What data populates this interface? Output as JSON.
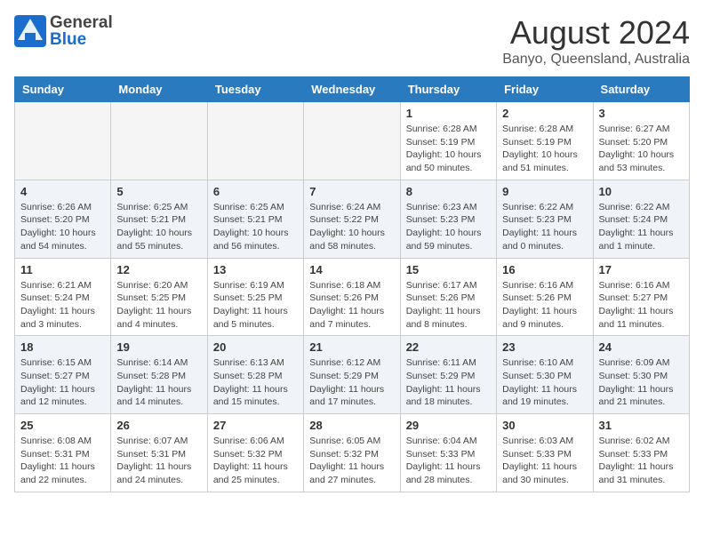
{
  "header": {
    "logo_general": "General",
    "logo_blue": "Blue",
    "month_title": "August 2024",
    "location": "Banyo, Queensland, Australia"
  },
  "weekdays": [
    "Sunday",
    "Monday",
    "Tuesday",
    "Wednesday",
    "Thursday",
    "Friday",
    "Saturday"
  ],
  "weeks": [
    [
      {
        "day": "",
        "info": ""
      },
      {
        "day": "",
        "info": ""
      },
      {
        "day": "",
        "info": ""
      },
      {
        "day": "",
        "info": ""
      },
      {
        "day": "1",
        "info": "Sunrise: 6:28 AM\nSunset: 5:19 PM\nDaylight: 10 hours\nand 50 minutes."
      },
      {
        "day": "2",
        "info": "Sunrise: 6:28 AM\nSunset: 5:19 PM\nDaylight: 10 hours\nand 51 minutes."
      },
      {
        "day": "3",
        "info": "Sunrise: 6:27 AM\nSunset: 5:20 PM\nDaylight: 10 hours\nand 53 minutes."
      }
    ],
    [
      {
        "day": "4",
        "info": "Sunrise: 6:26 AM\nSunset: 5:20 PM\nDaylight: 10 hours\nand 54 minutes."
      },
      {
        "day": "5",
        "info": "Sunrise: 6:25 AM\nSunset: 5:21 PM\nDaylight: 10 hours\nand 55 minutes."
      },
      {
        "day": "6",
        "info": "Sunrise: 6:25 AM\nSunset: 5:21 PM\nDaylight: 10 hours\nand 56 minutes."
      },
      {
        "day": "7",
        "info": "Sunrise: 6:24 AM\nSunset: 5:22 PM\nDaylight: 10 hours\nand 58 minutes."
      },
      {
        "day": "8",
        "info": "Sunrise: 6:23 AM\nSunset: 5:23 PM\nDaylight: 10 hours\nand 59 minutes."
      },
      {
        "day": "9",
        "info": "Sunrise: 6:22 AM\nSunset: 5:23 PM\nDaylight: 11 hours\nand 0 minutes."
      },
      {
        "day": "10",
        "info": "Sunrise: 6:22 AM\nSunset: 5:24 PM\nDaylight: 11 hours\nand 1 minute."
      }
    ],
    [
      {
        "day": "11",
        "info": "Sunrise: 6:21 AM\nSunset: 5:24 PM\nDaylight: 11 hours\nand 3 minutes."
      },
      {
        "day": "12",
        "info": "Sunrise: 6:20 AM\nSunset: 5:25 PM\nDaylight: 11 hours\nand 4 minutes."
      },
      {
        "day": "13",
        "info": "Sunrise: 6:19 AM\nSunset: 5:25 PM\nDaylight: 11 hours\nand 5 minutes."
      },
      {
        "day": "14",
        "info": "Sunrise: 6:18 AM\nSunset: 5:26 PM\nDaylight: 11 hours\nand 7 minutes."
      },
      {
        "day": "15",
        "info": "Sunrise: 6:17 AM\nSunset: 5:26 PM\nDaylight: 11 hours\nand 8 minutes."
      },
      {
        "day": "16",
        "info": "Sunrise: 6:16 AM\nSunset: 5:26 PM\nDaylight: 11 hours\nand 9 minutes."
      },
      {
        "day": "17",
        "info": "Sunrise: 6:16 AM\nSunset: 5:27 PM\nDaylight: 11 hours\nand 11 minutes."
      }
    ],
    [
      {
        "day": "18",
        "info": "Sunrise: 6:15 AM\nSunset: 5:27 PM\nDaylight: 11 hours\nand 12 minutes."
      },
      {
        "day": "19",
        "info": "Sunrise: 6:14 AM\nSunset: 5:28 PM\nDaylight: 11 hours\nand 14 minutes."
      },
      {
        "day": "20",
        "info": "Sunrise: 6:13 AM\nSunset: 5:28 PM\nDaylight: 11 hours\nand 15 minutes."
      },
      {
        "day": "21",
        "info": "Sunrise: 6:12 AM\nSunset: 5:29 PM\nDaylight: 11 hours\nand 17 minutes."
      },
      {
        "day": "22",
        "info": "Sunrise: 6:11 AM\nSunset: 5:29 PM\nDaylight: 11 hours\nand 18 minutes."
      },
      {
        "day": "23",
        "info": "Sunrise: 6:10 AM\nSunset: 5:30 PM\nDaylight: 11 hours\nand 19 minutes."
      },
      {
        "day": "24",
        "info": "Sunrise: 6:09 AM\nSunset: 5:30 PM\nDaylight: 11 hours\nand 21 minutes."
      }
    ],
    [
      {
        "day": "25",
        "info": "Sunrise: 6:08 AM\nSunset: 5:31 PM\nDaylight: 11 hours\nand 22 minutes."
      },
      {
        "day": "26",
        "info": "Sunrise: 6:07 AM\nSunset: 5:31 PM\nDaylight: 11 hours\nand 24 minutes."
      },
      {
        "day": "27",
        "info": "Sunrise: 6:06 AM\nSunset: 5:32 PM\nDaylight: 11 hours\nand 25 minutes."
      },
      {
        "day": "28",
        "info": "Sunrise: 6:05 AM\nSunset: 5:32 PM\nDaylight: 11 hours\nand 27 minutes."
      },
      {
        "day": "29",
        "info": "Sunrise: 6:04 AM\nSunset: 5:33 PM\nDaylight: 11 hours\nand 28 minutes."
      },
      {
        "day": "30",
        "info": "Sunrise: 6:03 AM\nSunset: 5:33 PM\nDaylight: 11 hours\nand 30 minutes."
      },
      {
        "day": "31",
        "info": "Sunrise: 6:02 AM\nSunset: 5:33 PM\nDaylight: 11 hours\nand 31 minutes."
      }
    ]
  ]
}
